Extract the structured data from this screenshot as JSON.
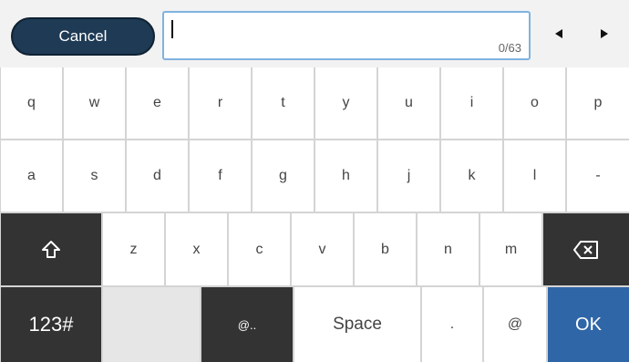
{
  "topbar": {
    "cancel_label": "Cancel",
    "field_value": "",
    "char_count": "0/63"
  },
  "icons": {
    "left_arrow": "left-arrow-icon",
    "right_arrow": "right-arrow-icon",
    "shift": "shift-icon",
    "backspace": "backspace-icon"
  },
  "keyboard": {
    "row1": [
      "q",
      "w",
      "e",
      "r",
      "t",
      "y",
      "u",
      "i",
      "o",
      "p"
    ],
    "row2": [
      "a",
      "s",
      "d",
      "f",
      "g",
      "h",
      "j",
      "k",
      "l",
      "-"
    ],
    "row3": [
      "z",
      "x",
      "c",
      "v",
      "b",
      "n",
      "m"
    ],
    "row4": {
      "mode_label": "123#",
      "domain_label": "@..",
      "space_label": "Space",
      "dot_label": ".",
      "at_label": "@",
      "ok_label": "OK"
    }
  },
  "colors": {
    "cancel_bg": "#1e3a54",
    "field_border": "#7fb3df",
    "dark_key": "#333333",
    "ok_key": "#2f66a8"
  }
}
